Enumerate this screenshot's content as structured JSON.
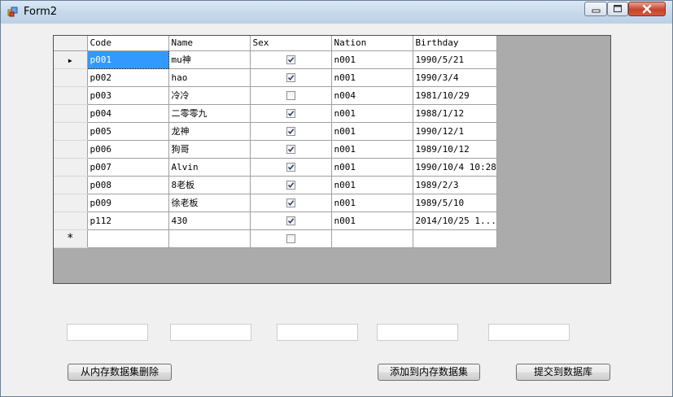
{
  "window": {
    "title": "Form2"
  },
  "grid": {
    "columns": [
      "Code",
      "Name",
      "Sex",
      "Nation",
      "Birthday"
    ],
    "rows": [
      {
        "code": "p001",
        "name": "mu神",
        "sex": true,
        "nation": "n001",
        "birthday": "1990/5/21"
      },
      {
        "code": "p002",
        "name": "hao",
        "sex": true,
        "nation": "n001",
        "birthday": "1990/3/4"
      },
      {
        "code": "p003",
        "name": "冷冷",
        "sex": false,
        "nation": "n004",
        "birthday": "1981/10/29"
      },
      {
        "code": "p004",
        "name": "二零零九",
        "sex": true,
        "nation": "n001",
        "birthday": "1988/1/12"
      },
      {
        "code": "p005",
        "name": "龙神",
        "sex": true,
        "nation": "n001",
        "birthday": "1990/12/1"
      },
      {
        "code": "p006",
        "name": "狗哥",
        "sex": true,
        "nation": "n001",
        "birthday": "1989/10/12"
      },
      {
        "code": "p007",
        "name": "Alvin",
        "sex": true,
        "nation": "n001",
        "birthday": "1990/10/4 10:28"
      },
      {
        "code": "p008",
        "name": "8老板",
        "sex": true,
        "nation": "n001",
        "birthday": "1989/2/3"
      },
      {
        "code": "p009",
        "name": "徐老板",
        "sex": true,
        "nation": "n001",
        "birthday": "1989/5/10"
      },
      {
        "code": "p112",
        "name": "430",
        "sex": true,
        "nation": "n001",
        "birthday": "2014/10/25 1..."
      }
    ],
    "current_row_glyph": "▶",
    "new_row_glyph": "*"
  },
  "buttons": {
    "delete": "从内存数据集删除",
    "add": "添加到内存数据集",
    "submit": "提交到数据库"
  },
  "textboxes": [
    "",
    "",
    "",
    "",
    ""
  ],
  "colors": {
    "selection": "#3399ff",
    "grid_background": "#ababab",
    "close_button": "#c7432c"
  }
}
